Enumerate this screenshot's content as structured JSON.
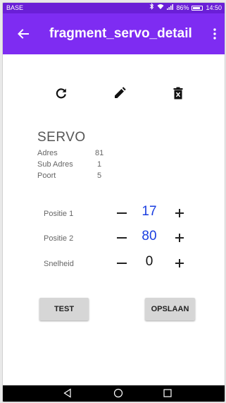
{
  "status_bar": {
    "carrier": "BASE",
    "battery": "86%",
    "time": "14:50"
  },
  "app_bar": {
    "title": "fragment_servo_detail",
    "back_icon": "arrow-back-icon",
    "menu_icon": "more-vert-icon"
  },
  "actions": {
    "refresh_icon": "refresh-icon",
    "edit_icon": "pencil-icon",
    "delete_icon": "trash-icon"
  },
  "servo": {
    "title": "SERVO",
    "fields": [
      {
        "label": "Adres",
        "value": "81"
      },
      {
        "label": "Sub Adres",
        "value": "1"
      },
      {
        "label": "Poort",
        "value": "5"
      }
    ]
  },
  "controls": [
    {
      "label": "Positie 1",
      "value": "17",
      "highlight": true
    },
    {
      "label": "Positie 2",
      "value": "80",
      "highlight": true
    },
    {
      "label": "Snelheid",
      "value": "0",
      "highlight": false
    }
  ],
  "buttons": {
    "test": "TEST",
    "save": "OPSLAAN"
  },
  "colors": {
    "status_bar": "#6a1fd6",
    "app_bar": "#7e2cf2",
    "value_accent": "#1a3ee0"
  }
}
